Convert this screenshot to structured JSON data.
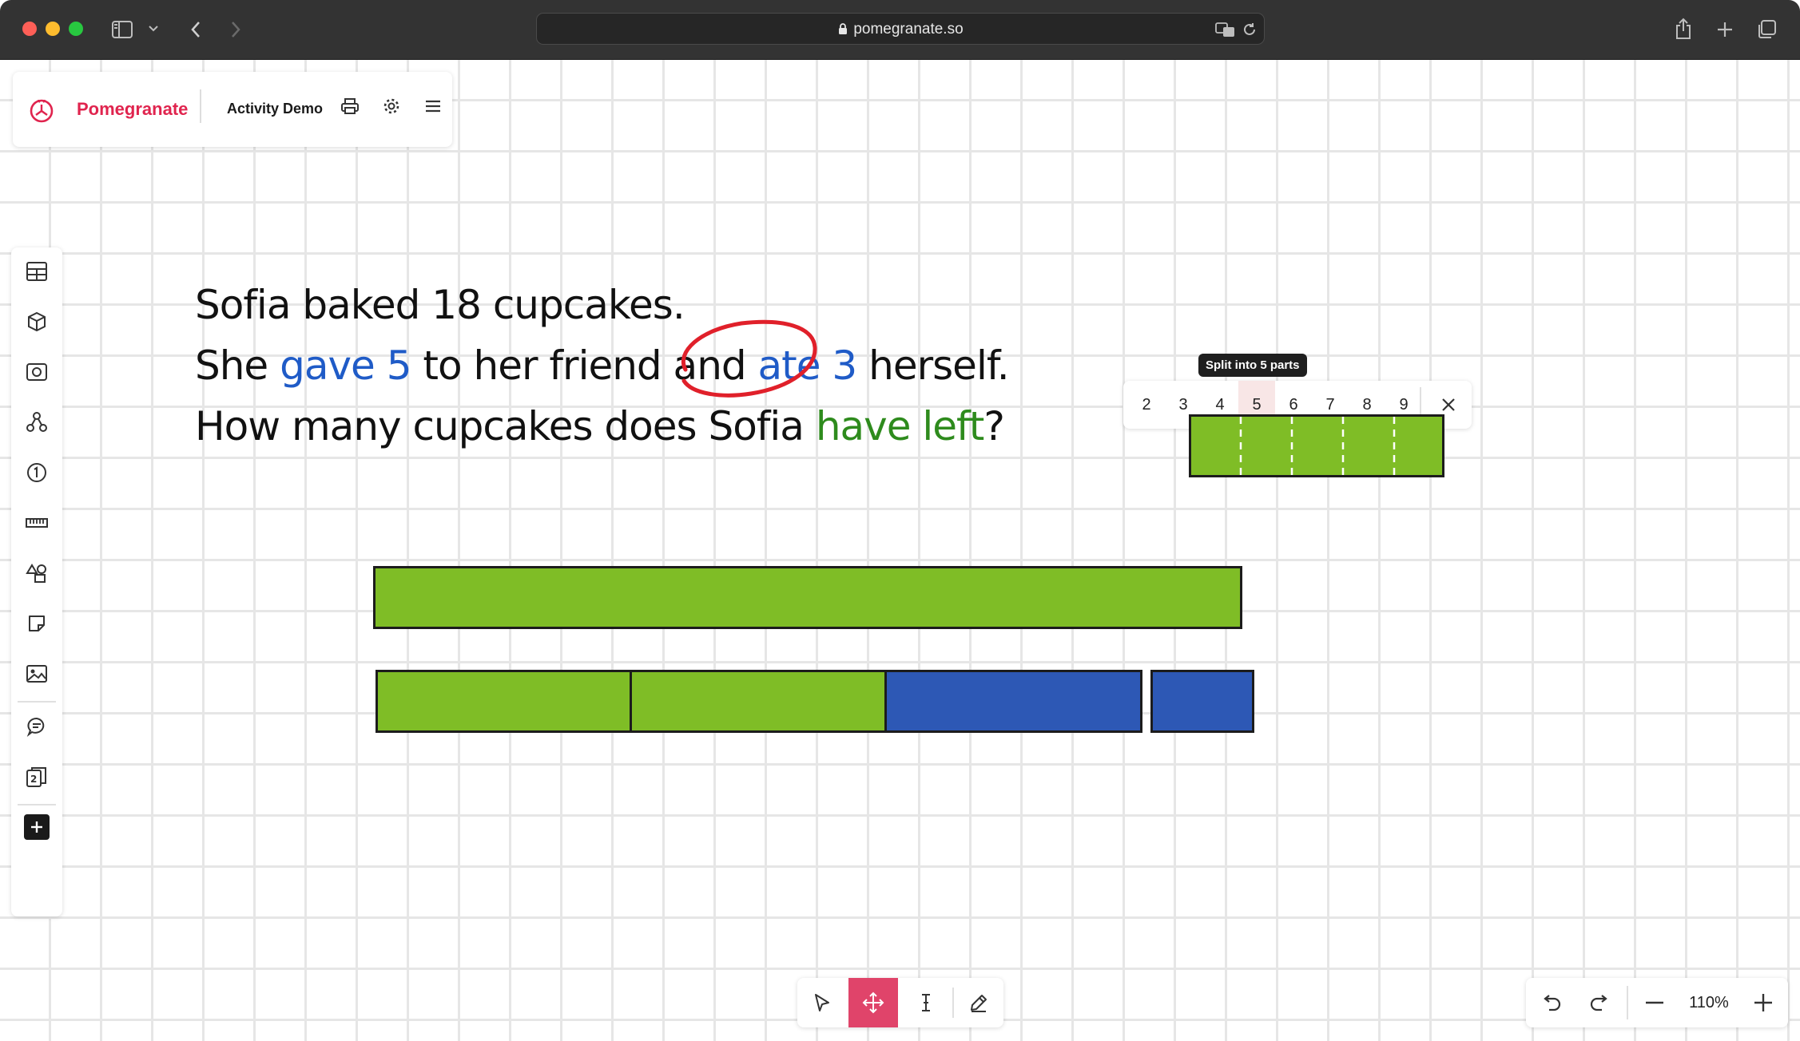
{
  "browser": {
    "url": "pomegranate.so"
  },
  "header": {
    "brand": "Pomegranate",
    "activity_title": "Activity Demo"
  },
  "problem": {
    "line1": "Sofia baked 18 cupcakes.",
    "line2_a": "She ",
    "line2_b": "gave 5",
    "line2_c": " to her friend and ",
    "line2_d": "ate 3",
    "line2_e": " herself.",
    "line3_a": "How many cupcakes does Sofia ",
    "line3_b": "have left",
    "line3_c": "?"
  },
  "split_menu": {
    "tooltip": "Split into 5 parts",
    "options": [
      "2",
      "3",
      "4",
      "5",
      "6",
      "7",
      "8",
      "9"
    ],
    "selected": "5"
  },
  "zoom": {
    "level": "110%"
  },
  "colors": {
    "brand": "#e0244e",
    "lime_bar": "#7fbd26",
    "blue_bar": "#2d58b5",
    "highlight_blue": "#1f5bc7",
    "highlight_green": "#2e8b1d",
    "annotation_red": "#e0202a",
    "active_tool": "#e0446a"
  },
  "icons": {
    "sidebar": [
      "layout-icon",
      "cube-icon",
      "camera-icon",
      "graph-icon",
      "number-one-icon",
      "ruler-icon",
      "shapes-icon",
      "sticky-note-icon",
      "image-icon",
      "comment-icon",
      "cards-icon",
      "add-icon"
    ],
    "toolbar": [
      "pointer-icon",
      "move-icon",
      "text-cursor-icon",
      "pencil-icon"
    ]
  }
}
